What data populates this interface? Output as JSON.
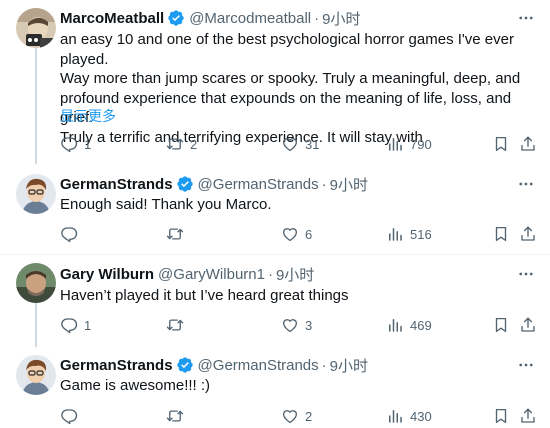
{
  "colors": {
    "accent": "#1d9bf0",
    "muted": "#536471",
    "text": "#0f1419",
    "divider": "#eff3f4"
  },
  "tweets": [
    {
      "name": "MarcoMeatball",
      "verified": true,
      "handle": "@Marcodmeatball",
      "time": "9小时",
      "lines": [
        "an easy 10 and one of the best psychological horror games I've ever played.",
        "Way more than jump scares or spooky. Truly a meaningful, deep, and",
        "profound experience that expounds on the meaning of life, loss, and grief.",
        "Truly a terrific and terrifying experience. It will stay with"
      ],
      "show_more": "显示更多",
      "reply_count": "1",
      "retweet_count": "2",
      "like_count": "31",
      "view_count": "790"
    },
    {
      "name": "GermanStrands",
      "verified": true,
      "handle": "@GermanStrands",
      "time": "9小时",
      "lines": [
        "Enough said! Thank you Marco."
      ],
      "reply_count": "",
      "retweet_count": "",
      "like_count": "6",
      "view_count": "516"
    },
    {
      "name": "Gary Wilburn",
      "verified": false,
      "handle": "@GaryWilburn1",
      "time": "9小时",
      "lines": [
        "Haven’t played it but I’ve heard great things"
      ],
      "reply_count": "1",
      "retweet_count": "",
      "like_count": "3",
      "view_count": "469"
    },
    {
      "name": "GermanStrands",
      "verified": true,
      "handle": "@GermanStrands",
      "time": "9小时",
      "lines": [
        "Game is awesome!!! :)"
      ],
      "reply_count": "",
      "retweet_count": "",
      "like_count": "2",
      "view_count": "430"
    }
  ]
}
